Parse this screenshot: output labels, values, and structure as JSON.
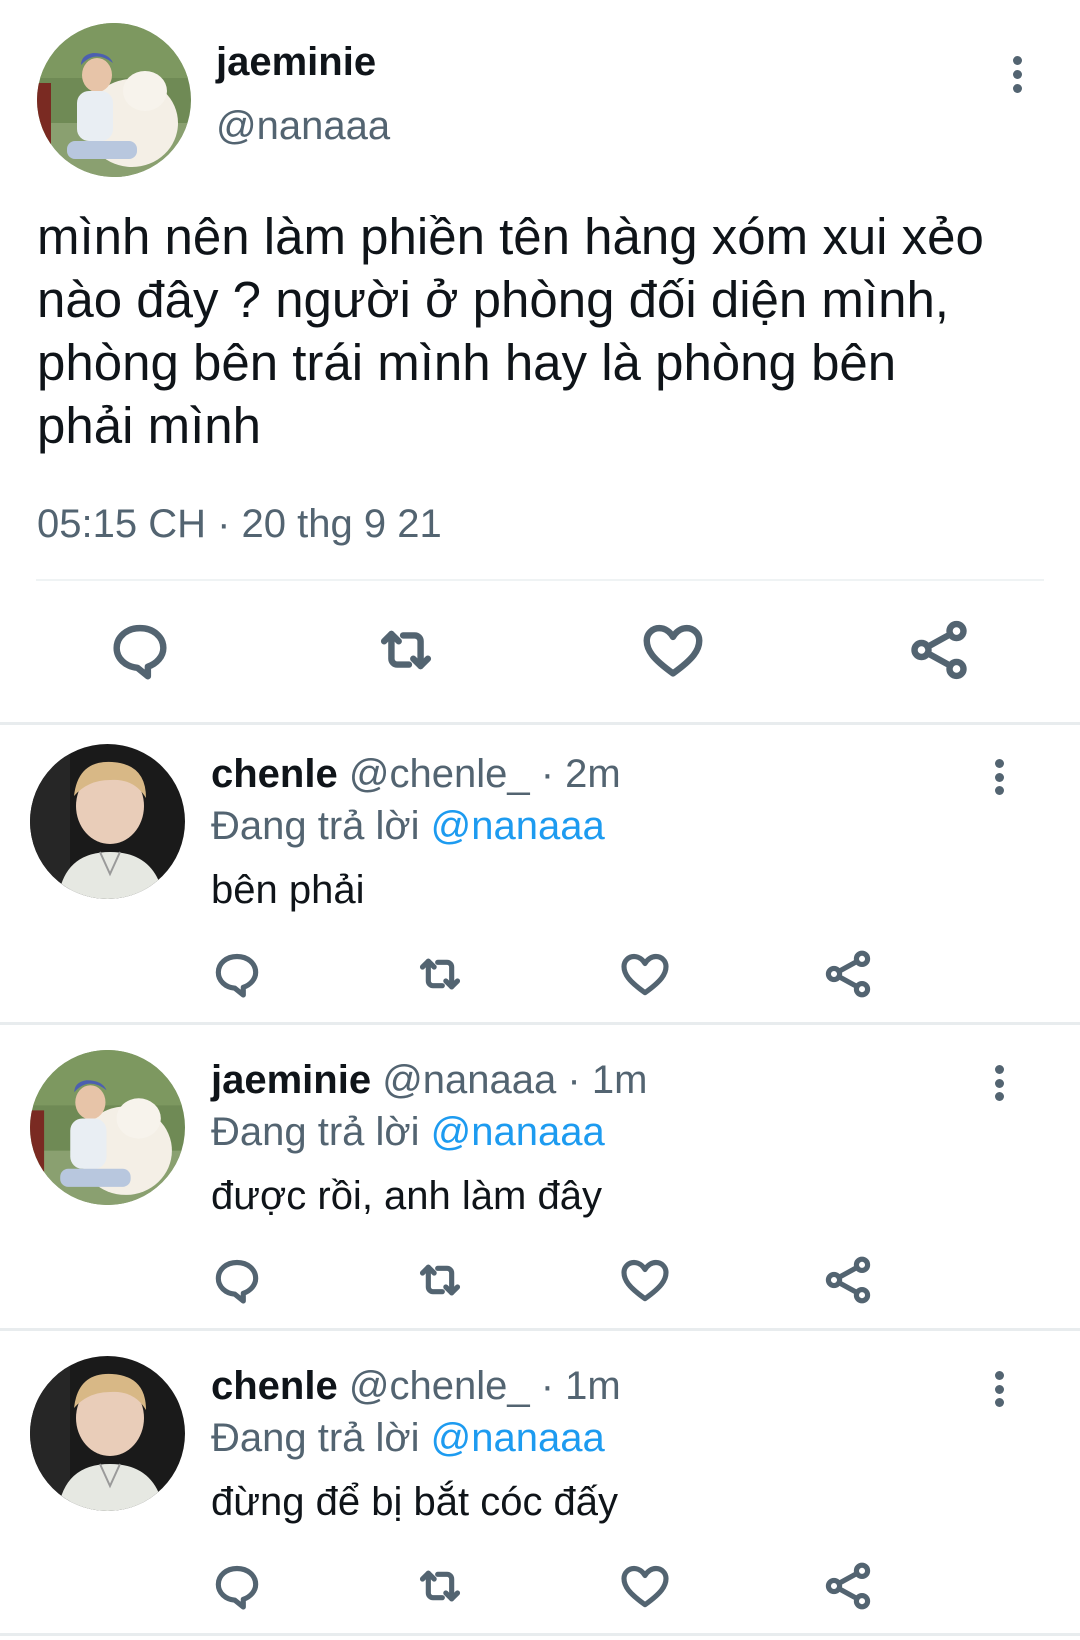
{
  "tweet": {
    "author_name": "jaeminie",
    "author_handle": "@nanaaa",
    "text_lines": [
      "mình nên làm phiền tên hàng xóm xui xẻo",
      "nào đây ? người ở phòng đối diện mình,",
      "phòng bên trái mình hay là phòng bên",
      "phải mình"
    ],
    "time": "05:15 CH · 20 thg 9 21",
    "avatar_icon": "avatar-photo-icon"
  },
  "replies": [
    {
      "name": "chenle",
      "handle": "@chenle_",
      "age": " · 2m",
      "replying_prefix": "Đang trả lời ",
      "replying_to": "@nanaaa",
      "text": "bên phải",
      "avatar_icon": "avatar-photo-icon"
    },
    {
      "name": "jaeminie",
      "handle": "@nanaaa",
      "age": " · 1m",
      "replying_prefix": "Đang trả lời ",
      "replying_to": "@nanaaa",
      "text": "được rồi, anh làm đây",
      "avatar_icon": "avatar-photo-icon"
    },
    {
      "name": "chenle",
      "handle": "@chenle_",
      "age": " · 1m",
      "replying_prefix": "Đang trả lời ",
      "replying_to": "@nanaaa",
      "text": "đừng để bị bắt cóc đấy",
      "avatar_icon": "avatar-photo-icon"
    }
  ],
  "actions": [
    "reply-icon",
    "retweet-icon",
    "like-icon",
    "share-icon"
  ],
  "colors": {
    "text": "#0f1419",
    "secondary": "#536471",
    "link": "#1d9bf0",
    "divider": "#eff3f4"
  }
}
